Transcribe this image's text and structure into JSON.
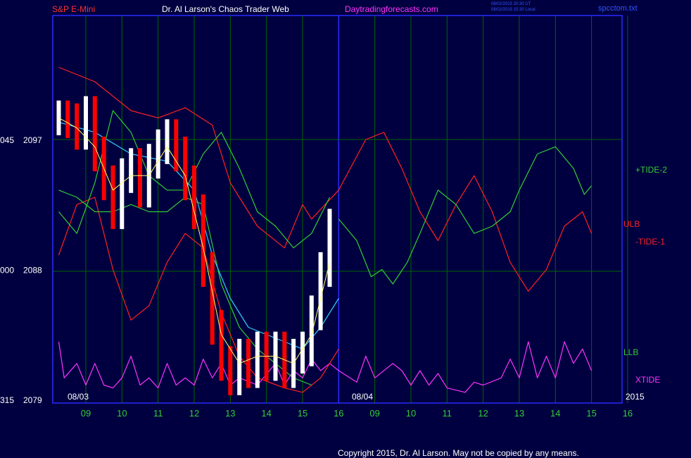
{
  "header": {
    "symbol": "S&P E-Mini",
    "site": "Dr. Al Larson's Chaos Trader Web",
    "url": "Daytradingforecasts.com",
    "timestamp_ut": "08/02/2015 20:30 UT",
    "timestamp_local": "08/02/2015 15:30 Local",
    "file": "spcctom.txt"
  },
  "copyright": "Copyright 2015, Dr. Al Larson. May not be copied by any means.",
  "colors": {
    "background": "#000040",
    "frame": "#2a2aff",
    "grid": "#006600",
    "price_up": "#ffffff",
    "price_down": "#ff0000",
    "moving_avg_fast": "#ffff66",
    "moving_avg_slow": "#33ccff",
    "tide_plus": "#33cc33",
    "tide_minus": "#ff2020",
    "xtide": "#ff33ff"
  },
  "chart_data": {
    "type": "line",
    "title": "",
    "x_ticks": [
      "09",
      "10",
      "11",
      "12",
      "13",
      "14",
      "15",
      "16",
      "09",
      "10",
      "11",
      "12",
      "13",
      "14",
      "15",
      "16"
    ],
    "date_labels": [
      "08/03",
      "08/04"
    ],
    "year_label": "2015",
    "y_axis": {
      "range": [
        2079,
        2101
      ],
      "ticks": [
        {
          "value": 2097,
          "label": "2097",
          "alt_label": "045"
        },
        {
          "value": 2088,
          "label": "2088",
          "alt_label": "000"
        },
        {
          "value": 2079,
          "label": "2079",
          "alt_label": "315"
        }
      ]
    },
    "x_range": [
      8.25,
      16.0
    ],
    "grid": true,
    "series_labels": [
      "+TIDE-2",
      "ULB",
      "-TIDE-1",
      "LLB",
      "XTIDE"
    ],
    "price": [
      [
        8.25,
        2098.5
      ],
      [
        8.5,
        2098.3
      ],
      [
        8.75,
        2097.5
      ],
      [
        9.0,
        2098.8
      ],
      [
        9.25,
        2096
      ],
      [
        9.5,
        2094
      ],
      [
        9.75,
        2092
      ],
      [
        10.0,
        2094.5
      ],
      [
        10.25,
        2095.2
      ],
      [
        10.5,
        2093.5
      ],
      [
        10.75,
        2095.5
      ],
      [
        11.0,
        2096.5
      ],
      [
        11.25,
        2097.2
      ],
      [
        11.5,
        2096
      ],
      [
        11.75,
        2094
      ],
      [
        12.0,
        2092
      ],
      [
        12.25,
        2088
      ],
      [
        12.5,
        2084
      ],
      [
        12.75,
        2081.5
      ],
      [
        13.0,
        2080.5
      ],
      [
        13.25,
        2082
      ],
      [
        13.5,
        2081
      ],
      [
        13.75,
        2082.5
      ],
      [
        14.0,
        2081.5
      ],
      [
        14.25,
        2082.5
      ],
      [
        14.5,
        2081
      ],
      [
        14.75,
        2082
      ],
      [
        15.0,
        2082.5
      ],
      [
        15.25,
        2085
      ],
      [
        15.5,
        2088
      ],
      [
        15.75,
        2091
      ]
    ],
    "ma_fast": [
      [
        8.25,
        2098.5
      ],
      [
        8.75,
        2097.8
      ],
      [
        9.25,
        2096.5
      ],
      [
        9.75,
        2093.5
      ],
      [
        10.25,
        2094.5
      ],
      [
        10.75,
        2094.5
      ],
      [
        11.25,
        2096.5
      ],
      [
        11.75,
        2094.5
      ],
      [
        12.25,
        2089.5
      ],
      [
        12.75,
        2083.5
      ],
      [
        13.25,
        2081.5
      ],
      [
        13.75,
        2082
      ],
      [
        14.25,
        2082
      ],
      [
        14.75,
        2081.5
      ],
      [
        15.25,
        2083.5
      ],
      [
        15.75,
        2088.5
      ]
    ],
    "ma_slow": [
      [
        8.25,
        2098.2
      ],
      [
        9.25,
        2097.5
      ],
      [
        10.25,
        2096
      ],
      [
        11.25,
        2095.5
      ],
      [
        12.0,
        2093.5
      ],
      [
        12.5,
        2089
      ],
      [
        13.0,
        2086
      ],
      [
        13.5,
        2084
      ],
      [
        14.0,
        2083.5
      ],
      [
        14.5,
        2083
      ],
      [
        15.0,
        2082.5
      ],
      [
        15.5,
        2084
      ],
      [
        16.0,
        2086
      ]
    ],
    "ulb": [
      [
        8.25,
        2102
      ],
      [
        9.25,
        2101
      ],
      [
        10.25,
        2099
      ],
      [
        11.0,
        2098.5
      ],
      [
        11.75,
        2099.2
      ],
      [
        12.5,
        2098
      ],
      [
        13.0,
        2094
      ],
      [
        13.75,
        2091
      ],
      [
        14.5,
        2089.5
      ],
      [
        15.0,
        2092.5
      ],
      [
        15.25,
        2091.5
      ],
      [
        16.0,
        2093.5
      ],
      [
        16.75,
        2097
      ],
      [
        17.25,
        2097.5
      ],
      [
        17.75,
        2095
      ],
      [
        18.25,
        2092
      ],
      [
        18.75,
        2090
      ],
      [
        19.25,
        2092.5
      ],
      [
        19.75,
        2094.5
      ],
      [
        20.25,
        2092
      ],
      [
        20.75,
        2088.5
      ],
      [
        21.25,
        2086.5
      ],
      [
        21.75,
        2088
      ],
      [
        22.25,
        2091
      ],
      [
        22.75,
        2092
      ],
      [
        23.0,
        2090.5
      ]
    ],
    "llb": [
      [
        8.25,
        2089
      ],
      [
        8.75,
        2092.5
      ],
      [
        9.25,
        2093
      ],
      [
        9.75,
        2088
      ],
      [
        10.25,
        2084.5
      ],
      [
        10.75,
        2085.5
      ],
      [
        11.25,
        2088.5
      ],
      [
        11.75,
        2090.5
      ],
      [
        12.25,
        2089.5
      ],
      [
        12.75,
        2085
      ],
      [
        13.25,
        2082
      ],
      [
        13.75,
        2080.5
      ],
      [
        14.5,
        2079.8
      ],
      [
        15.0,
        2079.5
      ],
      [
        15.5,
        2080.5
      ],
      [
        16.0,
        2082.5
      ]
    ],
    "tide_green_a": [
      [
        8.25,
        2093.5
      ],
      [
        8.75,
        2093
      ],
      [
        9.25,
        2092
      ],
      [
        9.75,
        2092
      ],
      [
        10.25,
        2092.5
      ],
      [
        10.75,
        2092
      ],
      [
        11.25,
        2092
      ],
      [
        11.75,
        2093
      ],
      [
        12.25,
        2092.5
      ],
      [
        12.75,
        2087
      ],
      [
        13.25,
        2084
      ],
      [
        13.75,
        2082.5
      ],
      [
        14.25,
        2081.5
      ],
      [
        14.75,
        2080.5
      ],
      [
        15.25,
        2080
      ]
    ],
    "tide_green_b": [
      [
        8.25,
        2092
      ],
      [
        8.75,
        2090.5
      ],
      [
        9.25,
        2094
      ],
      [
        9.75,
        2099
      ],
      [
        10.25,
        2097.5
      ],
      [
        10.75,
        2094.5
      ],
      [
        11.25,
        2093.5
      ],
      [
        11.75,
        2093.5
      ],
      [
        12.25,
        2096
      ],
      [
        12.75,
        2097.5
      ],
      [
        13.25,
        2095
      ],
      [
        13.75,
        2092
      ],
      [
        14.25,
        2091
      ],
      [
        14.75,
        2089.5
      ],
      [
        15.25,
        2090.5
      ],
      [
        15.75,
        2093
      ]
    ],
    "tide_forecast": [
      [
        16.0,
        2091.5
      ],
      [
        16.5,
        2090
      ],
      [
        16.9,
        2087.5
      ],
      [
        17.2,
        2088
      ],
      [
        17.5,
        2087
      ],
      [
        17.9,
        2088.5
      ],
      [
        18.25,
        2090.5
      ],
      [
        18.75,
        2093.5
      ],
      [
        19.25,
        2092.5
      ],
      [
        19.75,
        2090.5
      ],
      [
        20.25,
        2091
      ],
      [
        20.75,
        2092
      ],
      [
        21.0,
        2093.5
      ],
      [
        21.5,
        2096
      ],
      [
        22.0,
        2096.5
      ],
      [
        22.5,
        2095
      ],
      [
        22.8,
        2093.2
      ],
      [
        23.0,
        2093.8
      ]
    ],
    "xtide": [
      [
        8.25,
        2083
      ],
      [
        8.4,
        2080.5
      ],
      [
        8.75,
        2081.5
      ],
      [
        9.0,
        2080
      ],
      [
        9.25,
        2081.5
      ],
      [
        9.5,
        2080
      ],
      [
        9.75,
        2079.8
      ],
      [
        10.0,
        2080.5
      ],
      [
        10.25,
        2082
      ],
      [
        10.5,
        2080
      ],
      [
        10.75,
        2080.5
      ],
      [
        11.0,
        2079.8
      ],
      [
        11.25,
        2081.5
      ],
      [
        11.5,
        2080
      ],
      [
        11.75,
        2080.5
      ],
      [
        12.0,
        2080
      ],
      [
        12.25,
        2081.8
      ],
      [
        12.5,
        2080.5
      ],
      [
        12.75,
        2081.5
      ],
      [
        13.0,
        2080
      ],
      [
        13.25,
        2080.5
      ],
      [
        13.75,
        2080
      ],
      [
        14.25,
        2081.5
      ],
      [
        14.5,
        2080
      ],
      [
        14.75,
        2081
      ],
      [
        15.0,
        2080.5
      ],
      [
        15.25,
        2081.8
      ],
      [
        15.5,
        2081
      ],
      [
        15.75,
        2081.5
      ],
      [
        16.0,
        2081
      ],
      [
        16.5,
        2080.2
      ],
      [
        16.75,
        2082
      ],
      [
        17.0,
        2080.5
      ],
      [
        17.5,
        2081.5
      ],
      [
        17.75,
        2081
      ],
      [
        18.0,
        2080
      ],
      [
        18.25,
        2081
      ],
      [
        18.5,
        2080
      ],
      [
        18.75,
        2080.8
      ],
      [
        19.0,
        2079.8
      ],
      [
        19.5,
        2079.5
      ],
      [
        19.75,
        2080.2
      ],
      [
        20.0,
        2080
      ],
      [
        20.5,
        2080.5
      ],
      [
        20.75,
        2081.8
      ],
      [
        21.0,
        2080.5
      ],
      [
        21.25,
        2083
      ],
      [
        21.5,
        2080.5
      ],
      [
        21.75,
        2082
      ],
      [
        22.0,
        2080.5
      ],
      [
        22.25,
        2083
      ],
      [
        22.5,
        2081.5
      ],
      [
        22.75,
        2082.5
      ],
      [
        23.0,
        2081
      ]
    ]
  }
}
